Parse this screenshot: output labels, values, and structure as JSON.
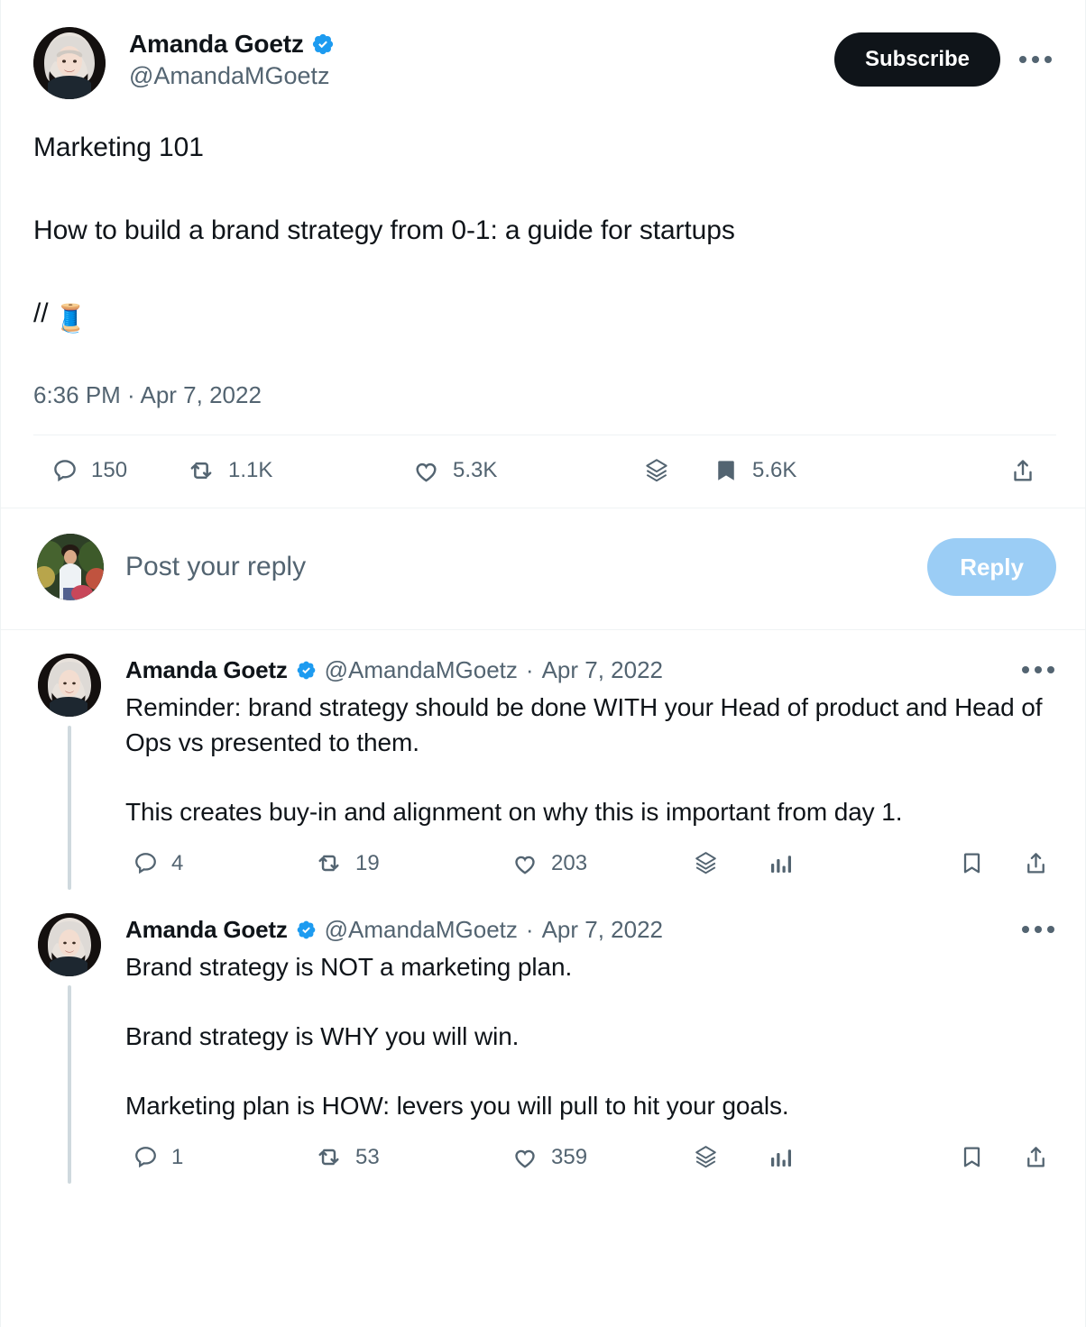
{
  "main_tweet": {
    "author": {
      "display_name": "Amanda Goetz",
      "handle": "@AmandaMGoetz",
      "verified_icon": "verified-badge-icon",
      "avatar_icon": "avatar-amanda-goetz"
    },
    "subscribe_label": "Subscribe",
    "more_icon": "more-options-icon",
    "lines": {
      "line1": "Marketing 101",
      "line2": "How to build a brand strategy from 0-1: a guide for startups",
      "line3": "//",
      "emoji": "🧵"
    },
    "timestamp": "6:36 PM · Apr 7, 2022",
    "metrics": {
      "reply_icon": "reply-icon",
      "reply_count": "150",
      "retweet_icon": "retweet-icon",
      "retweet_count": "1.1K",
      "like_icon": "like-icon",
      "like_count": "5.3K",
      "views_icon": "views-layers-icon",
      "bookmark_icon": "bookmark-icon",
      "bookmark_count": "5.6K",
      "share_icon": "share-icon"
    }
  },
  "composer": {
    "avatar_icon": "avatar-current-user",
    "placeholder": "Post your reply",
    "reply_button_label": "Reply"
  },
  "replies": [
    {
      "author": {
        "display_name": "Amanda Goetz",
        "handle": "@AmandaMGoetz",
        "verified_icon": "verified-badge-icon",
        "avatar_icon": "avatar-amanda-goetz"
      },
      "separator": "·",
      "date": "Apr 7, 2022",
      "more_icon": "more-options-icon",
      "paragraphs": {
        "p1": "Reminder: brand strategy should be done WITH your Head of product and Head of Ops vs presented to them.",
        "p2": "This creates buy-in and alignment on why this is important from day 1."
      },
      "metrics": {
        "reply_icon": "reply-icon",
        "reply_count": "4",
        "retweet_icon": "retweet-icon",
        "retweet_count": "19",
        "like_icon": "like-icon",
        "like_count": "203",
        "views_icon": "views-layers-icon",
        "analytics_icon": "analytics-bars-icon",
        "bookmark_icon": "bookmark-icon",
        "share_icon": "share-icon"
      }
    },
    {
      "author": {
        "display_name": "Amanda Goetz",
        "handle": "@AmandaMGoetz",
        "verified_icon": "verified-badge-icon",
        "avatar_icon": "avatar-amanda-goetz"
      },
      "separator": "·",
      "date": "Apr 7, 2022",
      "more_icon": "more-options-icon",
      "paragraphs": {
        "p1": "Brand strategy is NOT a marketing plan.",
        "p2": "Brand strategy is WHY you will win.",
        "p3": "Marketing plan is HOW: levers you will pull to hit your goals."
      },
      "metrics": {
        "reply_icon": "reply-icon",
        "reply_count": "1",
        "retweet_icon": "retweet-icon",
        "retweet_count": "53",
        "like_icon": "like-icon",
        "like_count": "359",
        "views_icon": "views-layers-icon",
        "analytics_icon": "analytics-bars-icon",
        "bookmark_icon": "bookmark-icon",
        "share_icon": "share-icon"
      }
    }
  ],
  "colors": {
    "text_primary": "#0f1419",
    "text_secondary": "#536471",
    "verified_blue": "#1d9bf0",
    "reply_button_bg": "#9bcdf5",
    "subscribe_bg": "#0f1419",
    "divider": "#eff3f4",
    "thread_line": "#cfd9de"
  }
}
